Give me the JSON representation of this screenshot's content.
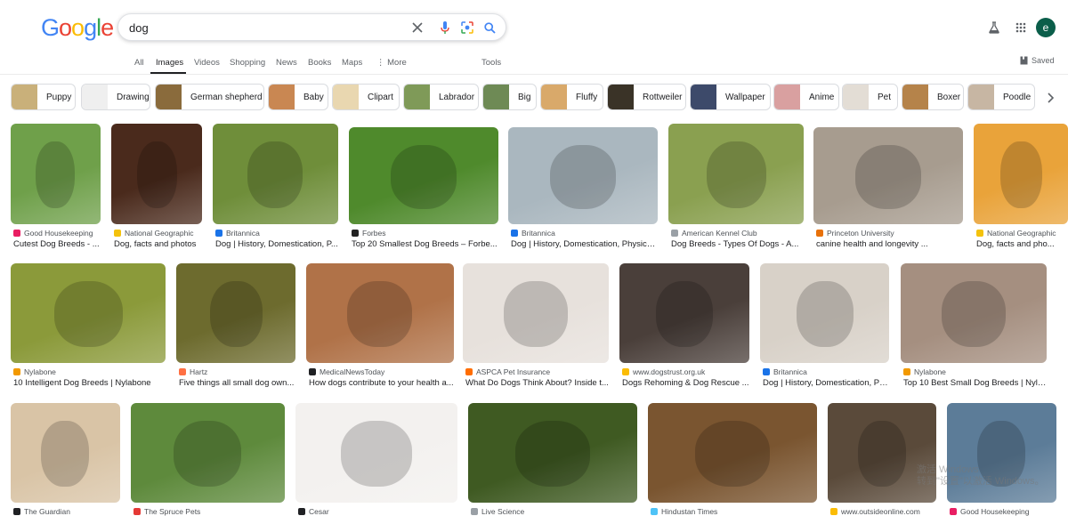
{
  "search": {
    "query": "dog"
  },
  "logo": {
    "letters": [
      "G",
      "o",
      "o",
      "g",
      "l",
      "e"
    ],
    "colors": [
      "#4285f4",
      "#ea4335",
      "#fbbc05",
      "#4285f4",
      "#34a853",
      "#ea4335"
    ]
  },
  "header_icons": {
    "clear": "close-icon",
    "voice": "microphone-icon",
    "lens": "lens-icon",
    "search": "search-icon",
    "labs": "flask-icon",
    "apps": "apps-grid-icon"
  },
  "user": {
    "avatar_letter": "e"
  },
  "nav": {
    "tabs": [
      "All",
      "Images",
      "Videos",
      "Shopping",
      "News",
      "Books",
      "Maps",
      "More"
    ],
    "tools": "Tools",
    "saved": "Saved"
  },
  "chips": [
    "Puppy",
    "Drawing",
    "German shepherd",
    "Baby",
    "Clipart",
    "Labrador",
    "Big",
    "Fluffy",
    "Rottweiler",
    "Wallpaper",
    "Anime",
    "Pet",
    "Boxer",
    "Poodle"
  ],
  "results": [
    {
      "source": "Good Housekeeping",
      "title": "Cutest Dog Breeds - ...",
      "color": "#6fa04a"
    },
    {
      "source": "National Geographic",
      "title": "Dog, facts and photos",
      "color": "#4a2a1c"
    },
    {
      "source": "Britannica",
      "title": "Dog | History, Domestication, P...",
      "color": "#6f8e3a"
    },
    {
      "source": "Forbes",
      "title": "Top 20 Smallest Dog Breeds – Forbe...",
      "color": "#4f8a2c"
    },
    {
      "source": "Britannica",
      "title": "Dog | History, Domestication, Physica...",
      "color": "#aab7bf"
    },
    {
      "source": "American Kennel Club",
      "title": "Dog Breeds - Types Of Dogs - A...",
      "color": "#8aa050"
    },
    {
      "source": "Princeton University",
      "title": "canine health and longevity ...",
      "color": "#a79c8f"
    },
    {
      "source": "National Geographic",
      "title": "Dog, facts and pho...",
      "color": "#e9a33a"
    },
    {
      "source": "Nylabone",
      "title": "10 Intelligent Dog Breeds | Nylabone",
      "color": "#8b9a3a"
    },
    {
      "source": "Hartz",
      "title": "Five things all small dog own...",
      "color": "#6d6b2e"
    },
    {
      "source": "MedicalNewsToday",
      "title": "How dogs contribute to your health a...",
      "color": "#b07248"
    },
    {
      "source": "ASPCA Pet Insurance",
      "title": "What Do Dogs Think About? Inside t...",
      "color": "#e7e1dc"
    },
    {
      "source": "www.dogstrust.org.uk",
      "title": "Dogs Rehoming & Dog Rescue ...",
      "color": "#4a3f3a"
    },
    {
      "source": "Britannica",
      "title": "Dog | History, Domestication, Ph...",
      "color": "#d8d1c8"
    },
    {
      "source": "Nylabone",
      "title": "Top 10 Best Small Dog Breeds | Nylab...",
      "color": "#a58f80"
    },
    {
      "source": "The Guardian",
      "title": "",
      "color": "#d9c4a6"
    },
    {
      "source": "The Spruce Pets",
      "title": "",
      "color": "#5e8a3c"
    },
    {
      "source": "Cesar",
      "title": "",
      "color": "#f3f1ef"
    },
    {
      "source": "Live Science",
      "title": "",
      "color": "#3f5a22"
    },
    {
      "source": "Hindustan Times",
      "title": "",
      "color": "#7a5530"
    },
    {
      "source": "www.outsideonline.com",
      "title": "",
      "color": "#5a4a3a"
    },
    {
      "source": "Good Housekeeping",
      "title": "",
      "color": "#5c7c98"
    }
  ],
  "watermark": {
    "line1": "激活 Windows",
    "line2": "转到\"设置\"以激活 Windows。"
  }
}
